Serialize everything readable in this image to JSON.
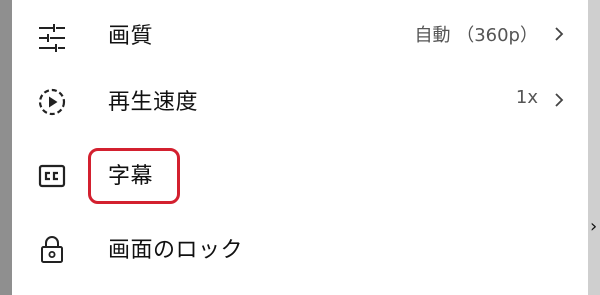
{
  "menu": {
    "items": [
      {
        "icon": "tune-icon",
        "label": "画質",
        "value": "自動 （360p）"
      },
      {
        "icon": "playback-speed-icon",
        "label": "再生速度",
        "value": "1x"
      },
      {
        "icon": "closed-captions-icon",
        "label": "字幕",
        "value": ""
      },
      {
        "icon": "lock-icon",
        "label": "画面のロック",
        "value": ""
      }
    ]
  },
  "colors": {
    "highlight": "#d3202f",
    "text": "#111111",
    "secondary_text": "#555555"
  }
}
